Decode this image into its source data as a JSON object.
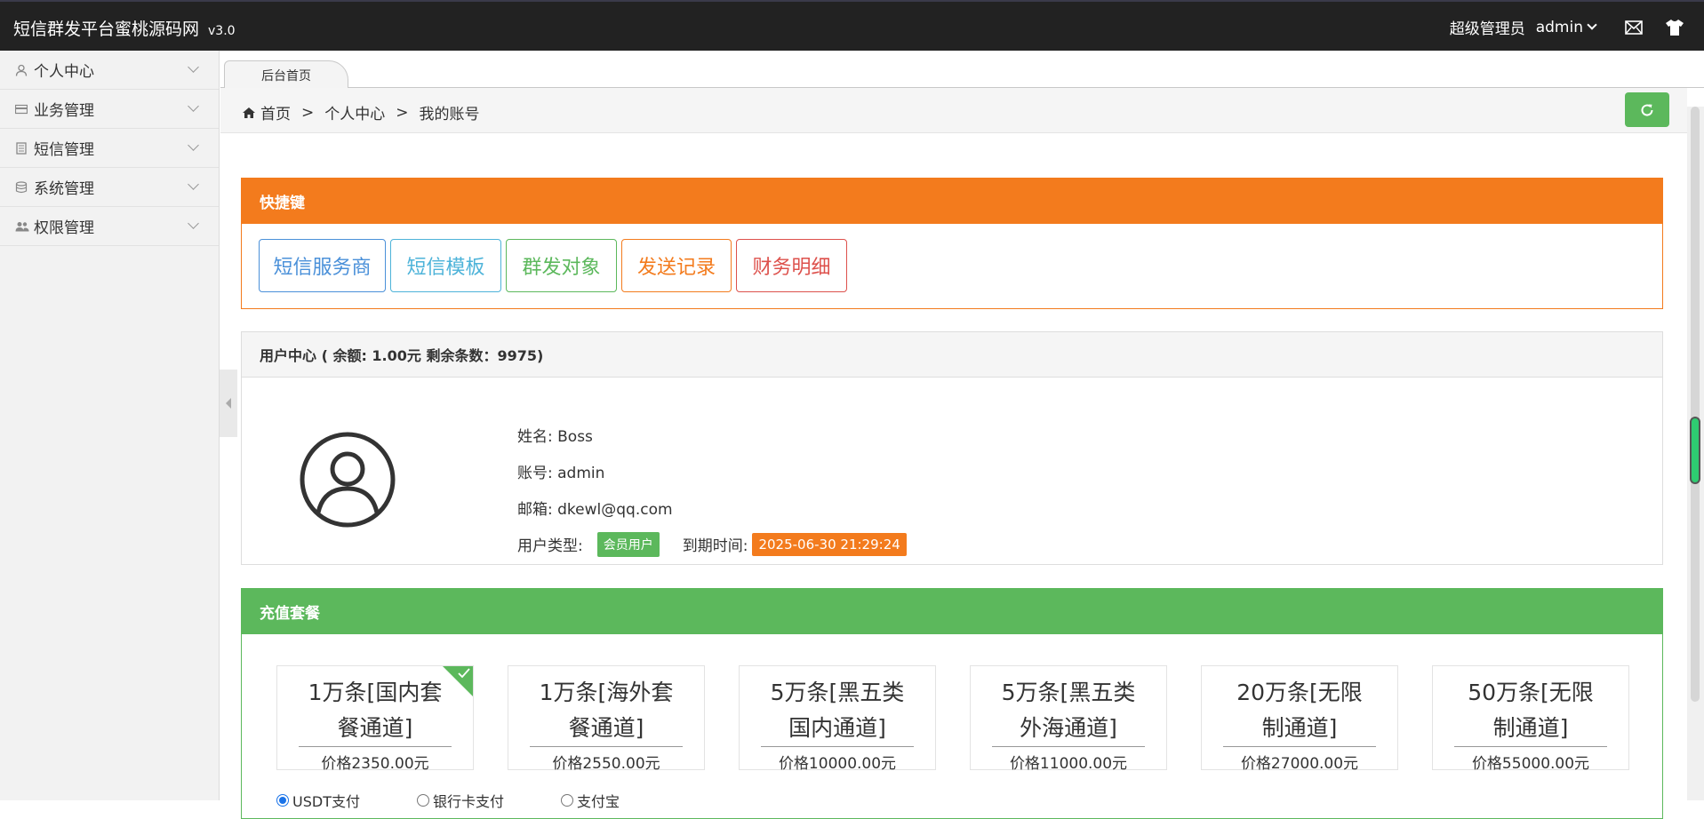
{
  "header": {
    "title": "短信群发平台蜜桃源码网",
    "version": "v3.0",
    "role": "超级管理员",
    "user": "admin"
  },
  "sidebar": {
    "items": [
      {
        "label": "个人中心",
        "icon": "user-icon"
      },
      {
        "label": "业务管理",
        "icon": "card-icon"
      },
      {
        "label": "短信管理",
        "icon": "book-icon"
      },
      {
        "label": "系统管理",
        "icon": "database-icon"
      },
      {
        "label": "权限管理",
        "icon": "users-icon"
      }
    ]
  },
  "tabs": [
    {
      "label": "后台首页"
    }
  ],
  "breadcrumb": {
    "items": [
      "首页",
      "个人中心",
      "我的账号"
    ],
    "separator": ">"
  },
  "quick": {
    "title": "快捷键",
    "buttons": [
      {
        "label": "短信服务商",
        "color": "#4a90d9",
        "width": 143
      },
      {
        "label": "短信模板",
        "color": "#4db3d9",
        "width": 125
      },
      {
        "label": "群发对象",
        "color": "#5cb85c",
        "width": 125
      },
      {
        "label": "发送记录",
        "color": "#f37b1d",
        "width": 124
      },
      {
        "label": "财务明细",
        "color": "#dd514c",
        "width": 125
      }
    ]
  },
  "user_panel": {
    "title": "用户中心 ( 余额: 1.00元 剩余条数：9975)",
    "name_line": "姓名: Boss",
    "account_line": "账号: admin",
    "email_line": "邮箱:  dkewl@qq.com",
    "type_label": "用户类型:",
    "type_badge": "会员用户",
    "expire_label": "到期时间:",
    "expire_badge": "2025-06-30 21:29:24"
  },
  "recharge": {
    "title": "充值套餐",
    "packages": [
      {
        "name": "1万条[国内套餐通道]",
        "price": "价格2350.00元",
        "selected": true
      },
      {
        "name": "1万条[海外套餐通道]",
        "price": "价格2550.00元",
        "selected": false
      },
      {
        "name": "5万条[黑五类国内通道]",
        "price": "价格10000.00元",
        "selected": false
      },
      {
        "name": "5万条[黑五类外海通道]",
        "price": "价格11000.00元",
        "selected": false
      },
      {
        "name": "20万条[无限制通道]",
        "price": "价格27000.00元",
        "selected": false
      },
      {
        "name": "50万条[无限制通道]",
        "price": "价格55000.00元",
        "selected": false
      }
    ],
    "payments": [
      {
        "label": "USDT支付",
        "checked": true
      },
      {
        "label": "银行卡支付",
        "checked": false
      },
      {
        "label": "支付宝",
        "checked": false
      }
    ]
  },
  "colors": {
    "header_bg": "#222222",
    "orange": "#f37b1d",
    "green": "#5cb85c"
  }
}
